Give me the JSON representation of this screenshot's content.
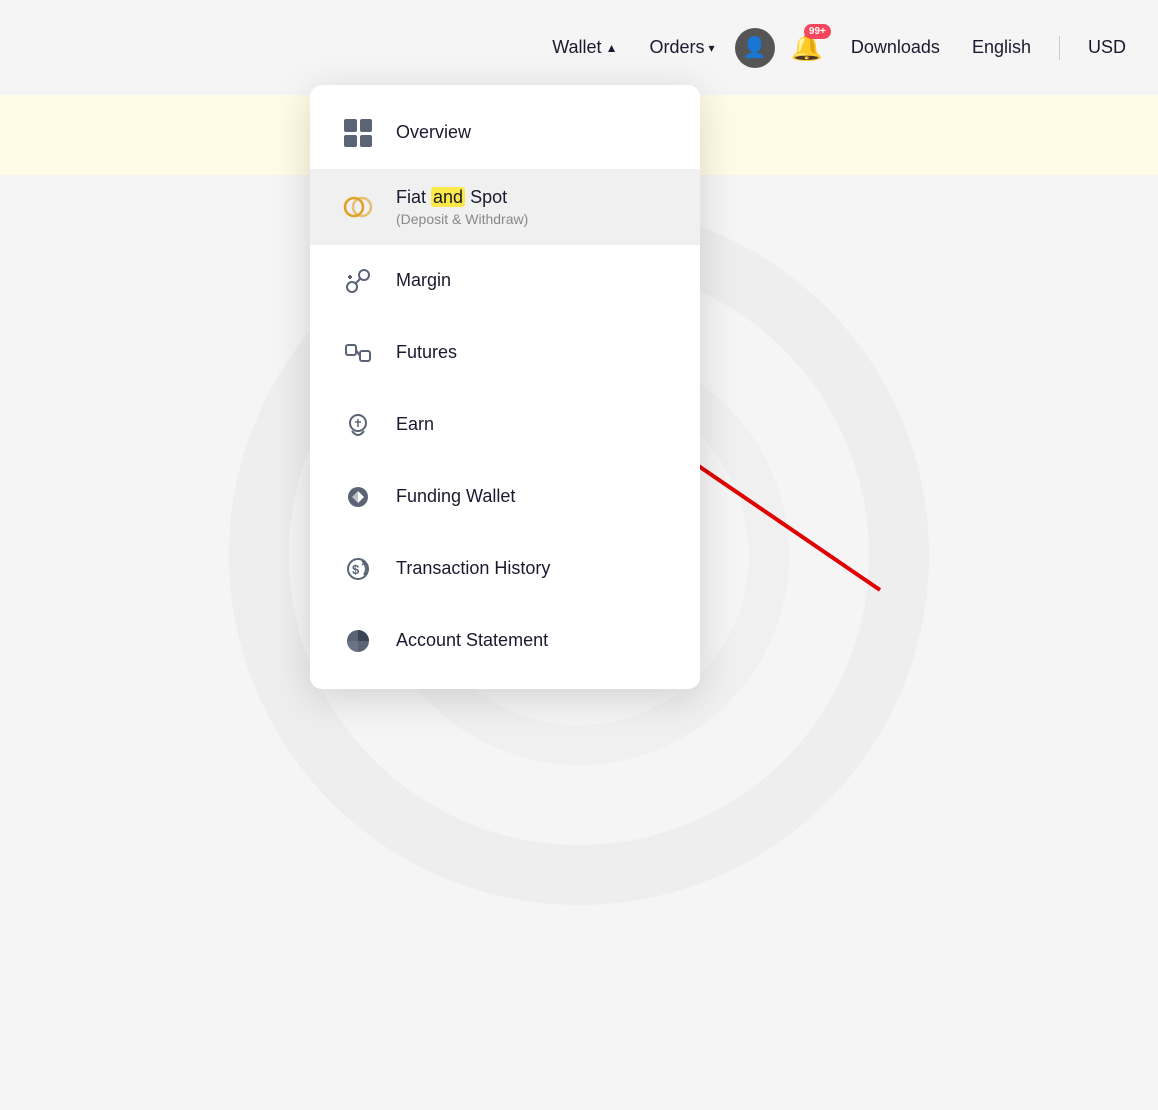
{
  "header": {
    "wallet_label": "Wallet",
    "orders_label": "Orders",
    "downloads_label": "Downloads",
    "english_label": "English",
    "usd_label": "USD",
    "bell_badge": "99+"
  },
  "dropdown": {
    "items": [
      {
        "id": "overview",
        "label": "Overview",
        "sublabel": "",
        "icon_type": "grid"
      },
      {
        "id": "fiat-and-spot",
        "label": "Fiat and Spot",
        "sublabel": "(Deposit & Withdraw)",
        "icon_type": "fiat"
      },
      {
        "id": "margin",
        "label": "Margin",
        "sublabel": "",
        "icon_type": "margin"
      },
      {
        "id": "futures",
        "label": "Futures",
        "sublabel": "",
        "icon_type": "futures"
      },
      {
        "id": "earn",
        "label": "Earn",
        "sublabel": "",
        "icon_type": "earn"
      },
      {
        "id": "funding-wallet",
        "label": "Funding Wallet",
        "sublabel": "",
        "icon_type": "funding"
      },
      {
        "id": "transaction-history",
        "label": "Transaction History",
        "sublabel": "",
        "icon_type": "transaction"
      },
      {
        "id": "account-statement",
        "label": "Account Statement",
        "sublabel": "",
        "icon_type": "account"
      }
    ]
  }
}
